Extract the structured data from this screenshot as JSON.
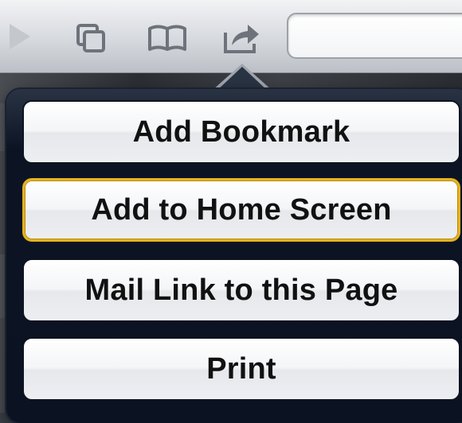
{
  "toolbar": {
    "buttons": [
      {
        "name": "back-button",
        "icon": "play-triangle-icon"
      },
      {
        "name": "tabs-button",
        "icon": "tabs-icon"
      },
      {
        "name": "bookmarks-button",
        "icon": "open-book-icon"
      },
      {
        "name": "share-button",
        "icon": "share-arrow-icon"
      }
    ],
    "address_value": ""
  },
  "share_menu": {
    "actions": [
      {
        "label": "Add Bookmark",
        "selected": false
      },
      {
        "label": "Add to Home Screen",
        "selected": true
      },
      {
        "label": "Mail Link to this Page",
        "selected": false
      },
      {
        "label": "Print",
        "selected": false
      }
    ]
  },
  "colors": {
    "selection_outline": "#e5b21a",
    "popover_background": "#0c1424",
    "icon_gray": "#6e737b"
  }
}
